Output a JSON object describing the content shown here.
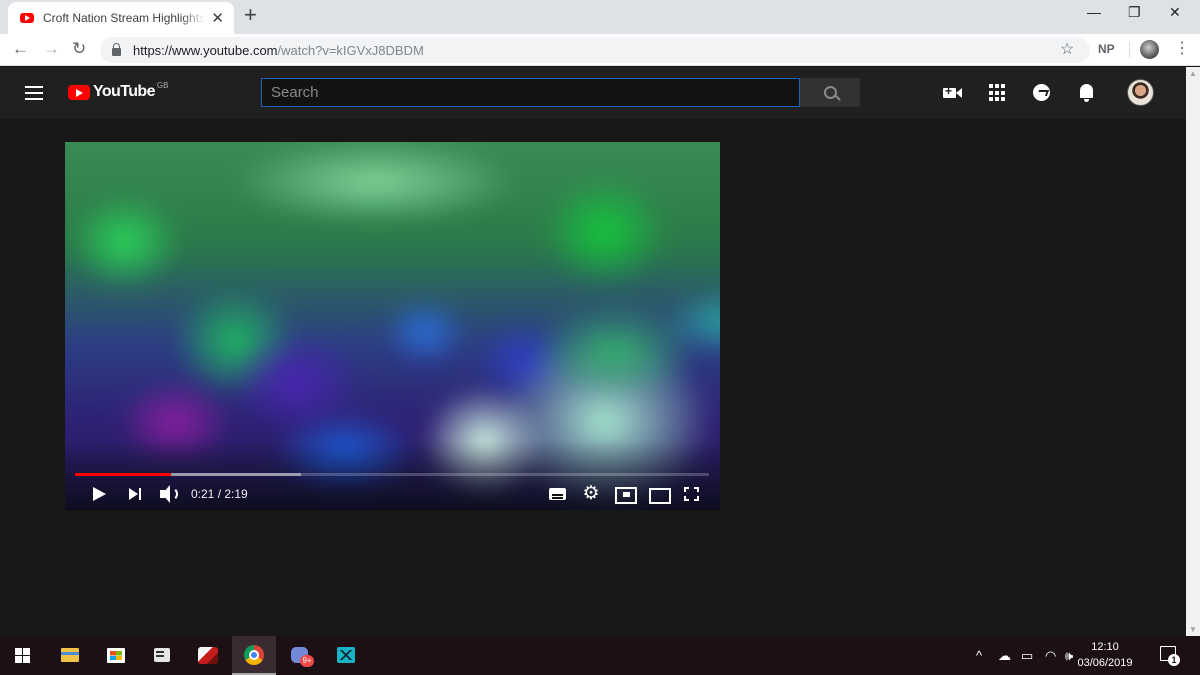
{
  "browser": {
    "tab_title": "Croft Nation Stream Highlights: N",
    "tab_close": "✕",
    "new_tab": "+",
    "window_controls": {
      "minimize": "—",
      "maximize": "❐",
      "close": "✕"
    },
    "nav": {
      "back": "←",
      "forward": "→",
      "reload": "↻"
    },
    "url_host": "https://www.youtube.com",
    "url_path": "/watch?v=kIGVxJ8DBDM",
    "bookmark_star": "☆",
    "extension_label": "NP",
    "menu": "⋮"
  },
  "youtube": {
    "logo_text": "YouTube",
    "region": "GB",
    "search_placeholder": "Search",
    "search_value": "",
    "header_icons": [
      "create-video-icon",
      "apps-grid-icon",
      "messages-icon",
      "notifications-bell-icon",
      "account-avatar"
    ]
  },
  "player": {
    "current_time": "0:21",
    "duration": "2:19",
    "timecode": "0:21 / 2:19",
    "played_fraction": 0.151,
    "buffered_fraction": 0.356,
    "gear_glyph": "⚙"
  },
  "colors": {
    "yt_bg": "#181818",
    "yt_header": "#202020",
    "progress_red": "#ff0000",
    "taskbar": "#1c1014"
  },
  "taskbar": {
    "apps": [
      "start-icon",
      "file-explorer-icon",
      "store-icon",
      "app-card-icon",
      "dragon-app-icon",
      "chrome-icon",
      "discord-icon",
      "camera-app-icon"
    ],
    "discord_badge": "9+",
    "tray": {
      "chevron": "^",
      "cloud": "☁",
      "battery": "▭",
      "wifi": "◠",
      "volume": "🕪"
    },
    "clock_time": "12:10",
    "clock_date": "03/06/2019",
    "notification_count": "1"
  }
}
